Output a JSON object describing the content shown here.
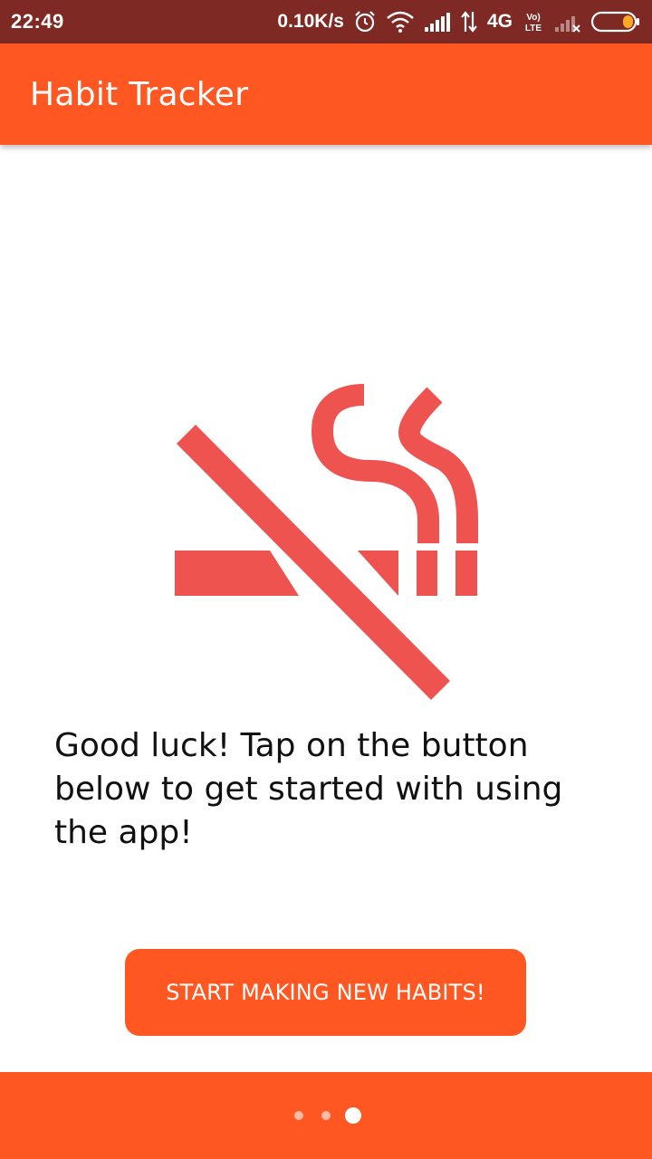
{
  "status_bar": {
    "time": "22:49",
    "speed": "0.10K/s",
    "network": "4G",
    "volte": "Vo)) LTE",
    "icons": [
      "alarm-icon",
      "wifi-icon",
      "signal-icon",
      "data-arrows-icon",
      "volte-icon",
      "no-signal-icon",
      "battery-icon"
    ]
  },
  "app_bar": {
    "title": "Habit Tracker"
  },
  "main": {
    "hero_icon": "no-smoking-icon",
    "message": "Good luck! Tap on the button below to get started with using the app!",
    "button_label": "START MAKING NEW HABITS!"
  },
  "pager": {
    "total_pages": 3,
    "current_page": 3
  },
  "colors": {
    "primary": "#ff5722",
    "status_bar": "#7e2923",
    "icon": "#ef5350",
    "text": "#111111"
  }
}
